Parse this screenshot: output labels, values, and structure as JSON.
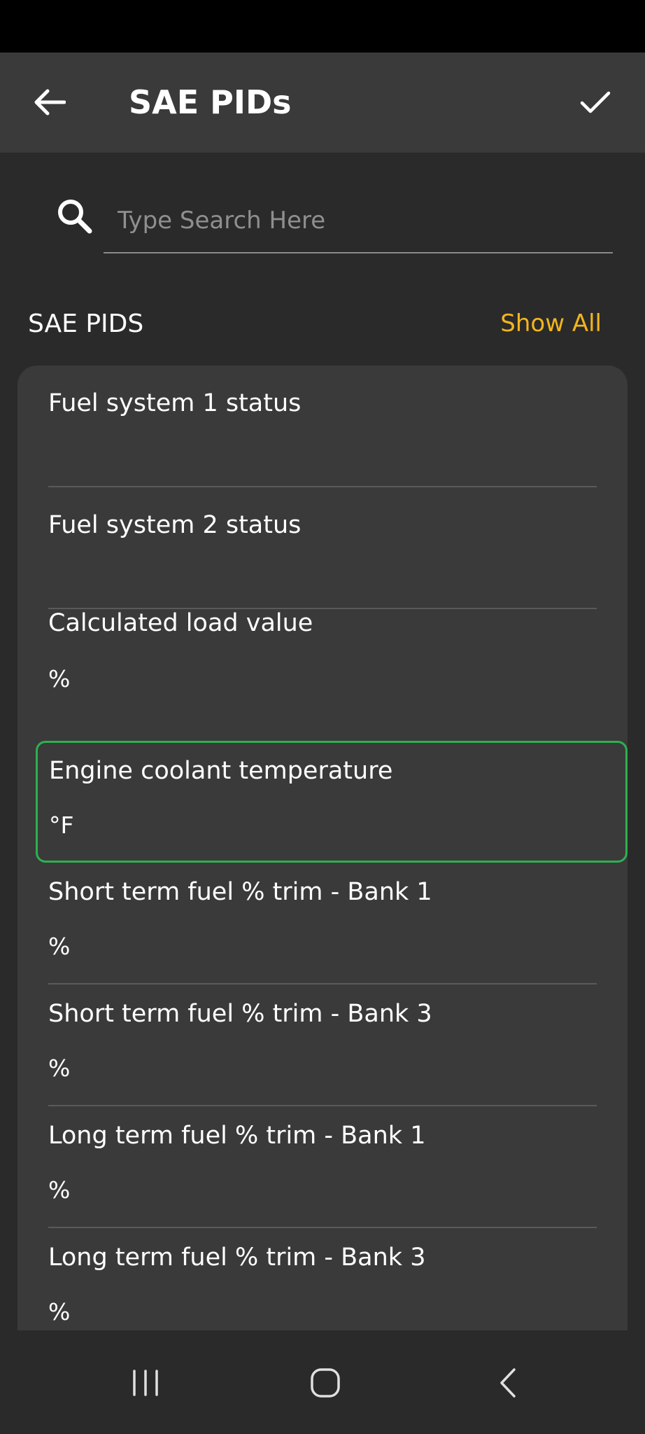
{
  "app_bar": {
    "title": "SAE PIDs"
  },
  "search": {
    "placeholder": "Type Search Here"
  },
  "section": {
    "title": "SAE PIDS",
    "show_all": "Show All"
  },
  "items": [
    {
      "name": "Fuel system 1 status",
      "unit": ""
    },
    {
      "name": "Fuel system 2 status",
      "unit": ""
    },
    {
      "name": "Calculated load value",
      "unit": "%"
    },
    {
      "name": "Engine coolant temperature",
      "unit": "°F"
    },
    {
      "name": "Short term fuel % trim - Bank 1",
      "unit": "%"
    },
    {
      "name": "Short term fuel % trim - Bank 3",
      "unit": "%"
    },
    {
      "name": "Long term fuel % trim - Bank 1",
      "unit": "%"
    },
    {
      "name": "Long term fuel % trim - Bank 3",
      "unit": "%"
    }
  ],
  "colors": {
    "accent": "#f2b51d",
    "selected_border": "#2eb04f",
    "background": "#2a2a2a",
    "surface": "#3a3a3a"
  }
}
